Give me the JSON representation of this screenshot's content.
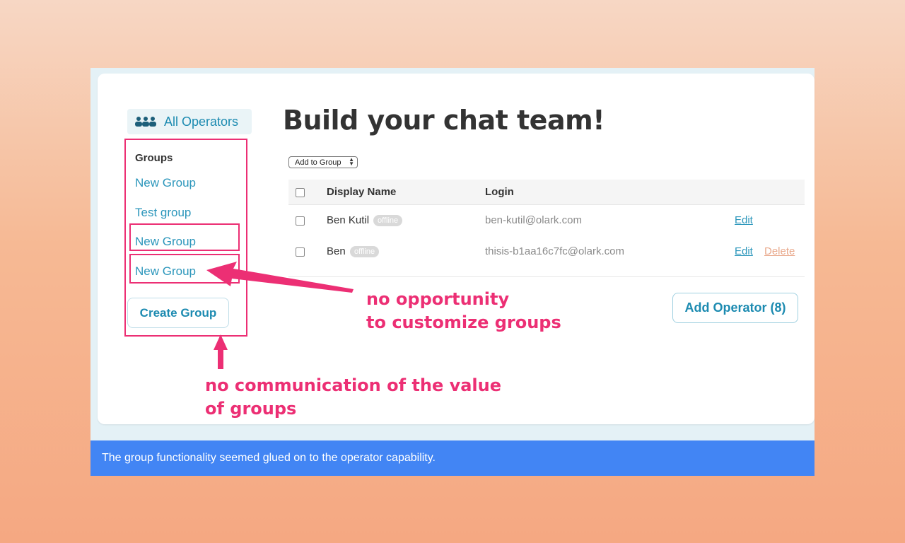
{
  "sidebar": {
    "all_operators": "All Operators",
    "groups_heading": "Groups",
    "groups": [
      "New Group",
      "Test group",
      "New Group",
      "New Group"
    ],
    "create_group": "Create Group"
  },
  "main": {
    "title": "Build your chat team!",
    "add_to_group": "Add to Group",
    "columns": [
      "Display Name",
      "Login"
    ],
    "rows": [
      {
        "name": "Ben Kutil",
        "status": "offline",
        "login": "ben-kutil@olark.com",
        "edit": "Edit",
        "delete": ""
      },
      {
        "name": "Ben",
        "status": "offline",
        "login": "thisis-b1aa16c7fc@olark.com",
        "edit": "Edit",
        "delete": "Delete"
      }
    ],
    "add_operator": "Add Operator (8)"
  },
  "annotations": {
    "customize_line1": "no opportunity",
    "customize_line2": "to customize groups",
    "value_line1": "no communication of the value",
    "value_line2": "of groups",
    "color": "#ec2f74"
  },
  "caption": "The group functionality seemed glued on to the operator capability."
}
